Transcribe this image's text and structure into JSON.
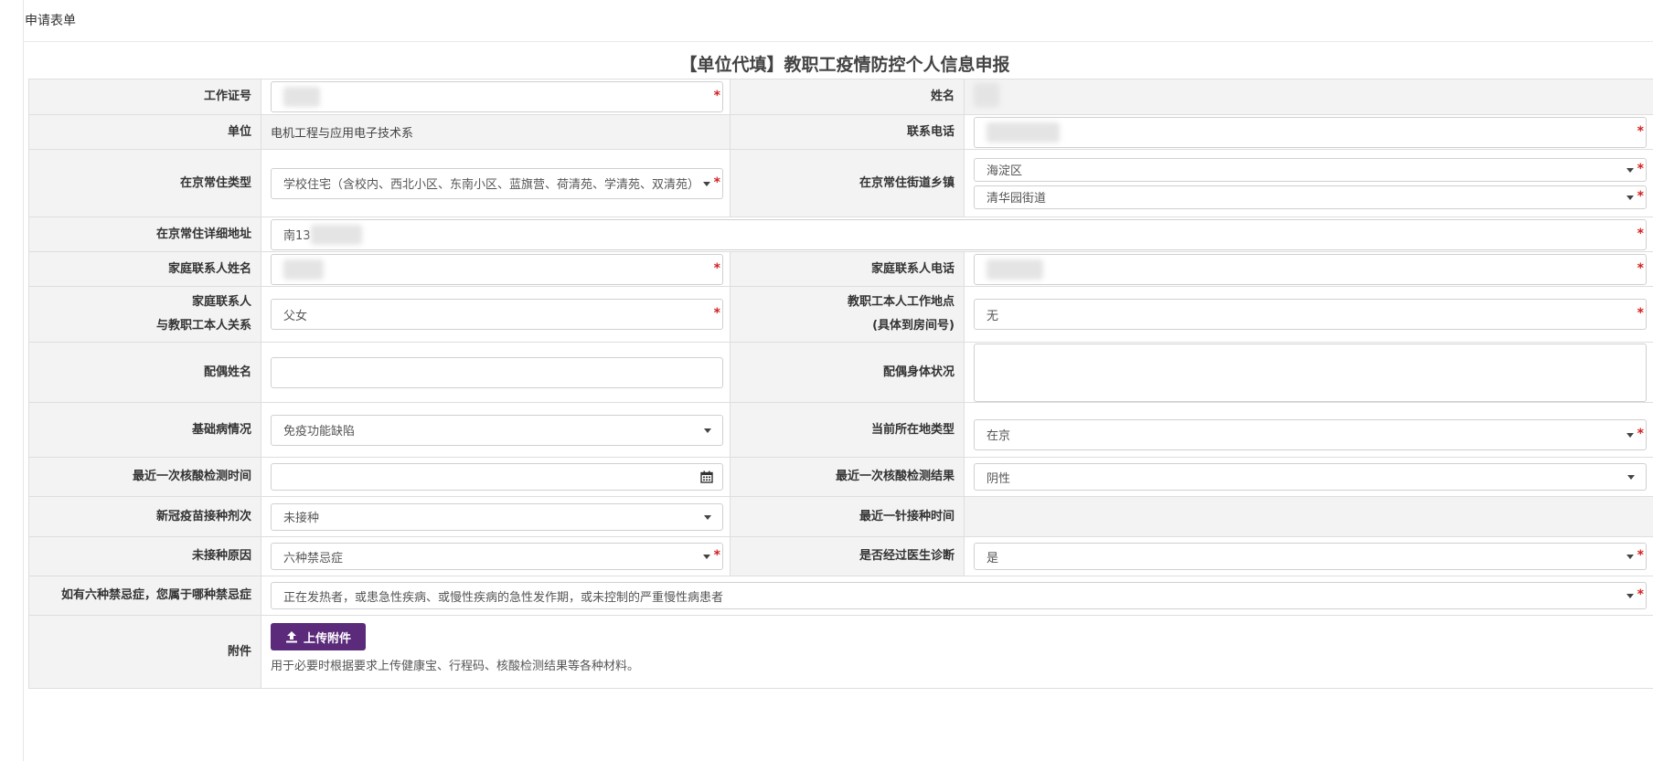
{
  "panel": {
    "heading": "申请表单"
  },
  "form": {
    "title": "【单位代填】教职工疫情防控个人信息申报"
  },
  "fields": {
    "work_id": {
      "label": "工作证号"
    },
    "name": {
      "label": "姓名"
    },
    "unit": {
      "label": "单位",
      "value": "电机工程与应用电子技术系"
    },
    "phone": {
      "label": "联系电话"
    },
    "residence_type": {
      "label": "在京常住类型",
      "value": "学校住宅（含校内、西北小区、东南小区、蓝旗营、荷清苑、学清苑、双清苑）"
    },
    "residence_street": {
      "label": "在京常住街道乡镇",
      "district": "海淀区",
      "street": "清华园街道"
    },
    "address": {
      "label": "在京常住详细地址",
      "value_prefix": "南13"
    },
    "family_contact_name": {
      "label": "家庭联系人姓名"
    },
    "family_contact_phone": {
      "label": "家庭联系人电话"
    },
    "family_relation": {
      "label_line1": "家庭联系人",
      "label_line2": "与教职工本人关系",
      "value": "父女"
    },
    "work_location": {
      "label_line1": "教职工本人工作地点",
      "label_line2": "(具体到房间号)",
      "value": "无"
    },
    "spouse_name": {
      "label": "配偶姓名",
      "value": ""
    },
    "spouse_health": {
      "label": "配偶身体状况",
      "value": ""
    },
    "underlying_disease": {
      "label": "基础病情况",
      "value": "免疫功能缺陷"
    },
    "current_location_type": {
      "label": "当前所在地类型",
      "value": "在京"
    },
    "last_test_time": {
      "label": "最近一次核酸检测时间",
      "value": ""
    },
    "last_test_result": {
      "label": "最近一次核酸检测结果",
      "value": "阴性"
    },
    "vaccine_doses": {
      "label": "新冠疫苗接种剂次",
      "value": "未接种"
    },
    "last_dose_time": {
      "label": "最近一针接种时间"
    },
    "not_vaccinated_reason": {
      "label": "未接种原因",
      "value": "六种禁忌症"
    },
    "doctor_diagnosed": {
      "label": "是否经过医生诊断",
      "value": "是"
    },
    "contraindication": {
      "label": "如有六种禁忌症，您属于哪种禁忌症",
      "value": "正在发热者，或患急性疾病、或慢性疾病的急性发作期，或未控制的严重慢性病患者"
    },
    "attachment": {
      "label": "附件",
      "button": "上传附件",
      "hint": "用于必要时根据要求上传健康宝、行程码、核酸检测结果等各种材料。"
    }
  },
  "required_mark": "*",
  "colors": {
    "button": "#5b2a7a",
    "required": "#d62020",
    "label_bg": "#f3f3f3"
  }
}
